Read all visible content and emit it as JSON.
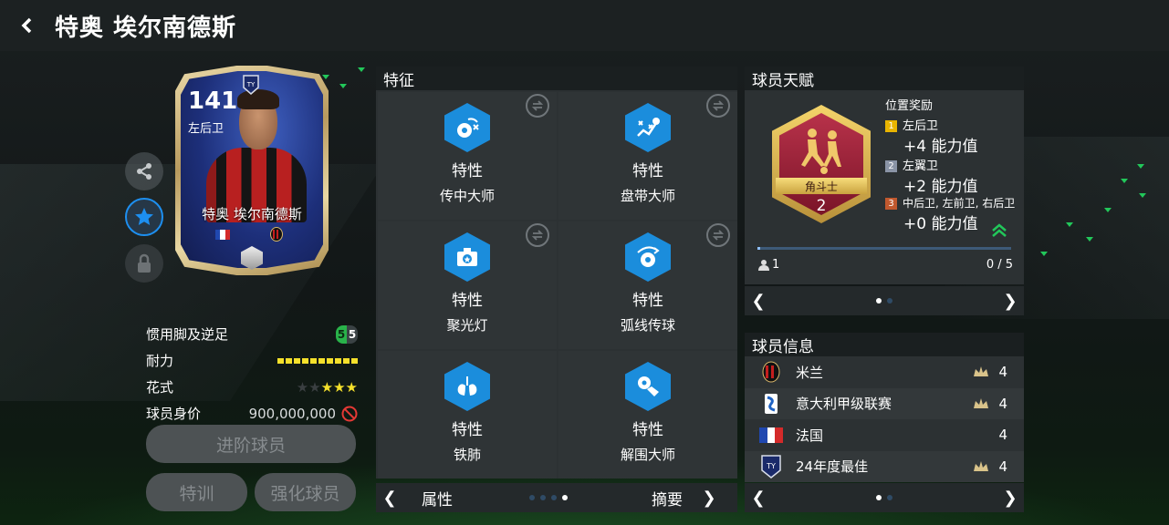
{
  "header": {
    "title": "特奥 埃尔南德斯"
  },
  "card": {
    "rating": "141",
    "position": "左后卫",
    "name": "特奥 埃尔南德斯"
  },
  "stats": {
    "weak_foot_label": "惯用脚及逆足",
    "weak_foot_left": "5",
    "weak_foot_right": "5",
    "stamina_label": "耐力",
    "stamina_level": 10,
    "skill_label": "花式",
    "skill_stars": 3,
    "skill_stars_max": 5,
    "price_label": "球员身价",
    "price_value": "900,000,000"
  },
  "buttons": {
    "advance": "进阶球员",
    "train": "特训",
    "enhance": "强化球员"
  },
  "features": {
    "title": "特征",
    "items": [
      {
        "label": "特性",
        "name": "传中大师",
        "icon": "cross-master-icon"
      },
      {
        "label": "特性",
        "name": "盘带大师",
        "icon": "dribble-master-icon"
      },
      {
        "label": "特性",
        "name": "聚光灯",
        "icon": "spotlight-icon"
      },
      {
        "label": "特性",
        "name": "弧线传球",
        "icon": "curve-pass-icon"
      },
      {
        "label": "特性",
        "name": "铁肺",
        "icon": "iron-lungs-icon"
      },
      {
        "label": "特性",
        "name": "解围大师",
        "icon": "clearance-master-icon"
      }
    ],
    "pager_left": "属性",
    "pager_right": "摘要"
  },
  "talent": {
    "title": "球员天赋",
    "badge_name": "角斗士",
    "badge_level": "2",
    "bonus_title": "位置奖励",
    "bonuses": [
      {
        "num": "1",
        "positions": "左后卫",
        "value": "+4 能力值",
        "color": "#e8b400"
      },
      {
        "num": "2",
        "positions": "左翼卫",
        "value": "+2 能力值",
        "color": "#8a94a6"
      },
      {
        "num": "3",
        "positions": "中后卫, 左前卫, 右后卫",
        "value": "+0 能力值",
        "color": "#c0582e"
      }
    ],
    "owner_count": "1",
    "progress_text": "0 / 5"
  },
  "info": {
    "title": "球员信息",
    "rows": [
      {
        "name": "米兰",
        "rating": "4",
        "icon": "ac-milan-crest-icon"
      },
      {
        "name": "意大利甲级联赛",
        "rating": "4",
        "icon": "serie-a-logo-icon"
      },
      {
        "name": "法国",
        "rating": "4",
        "icon": "france-flag-icon"
      },
      {
        "name": "24年度最佳",
        "rating": "4",
        "icon": "toty-badge-icon"
      }
    ]
  },
  "colors": {
    "accent_blue": "#1b8ddc",
    "stamina_yellow": "#f5e02b",
    "star_yellow": "#f5e02b",
    "prohibit_red": "#e53935"
  }
}
